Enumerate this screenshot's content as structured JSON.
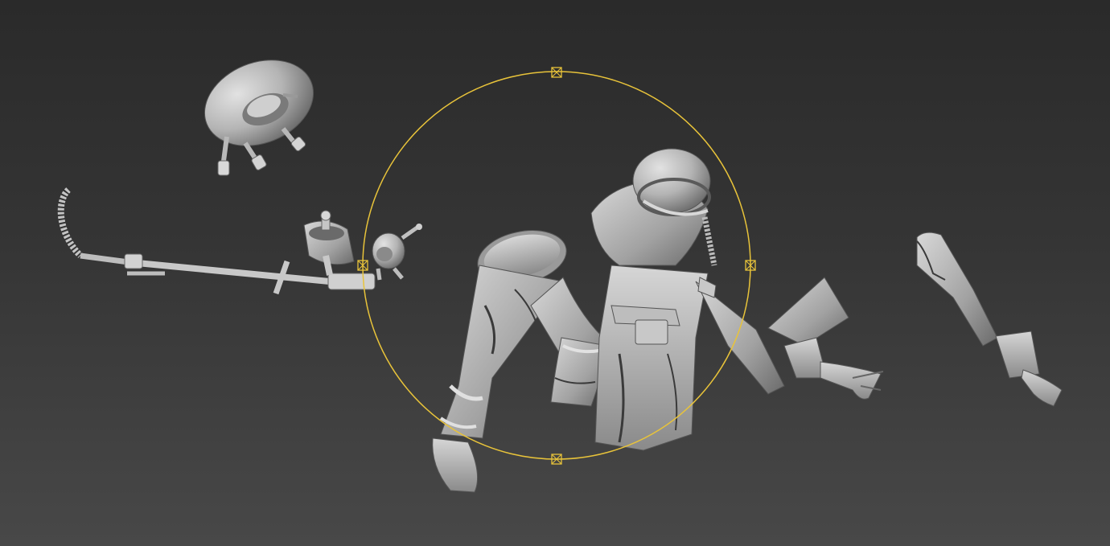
{
  "viewport": {
    "background_top": "#2a2a2a",
    "background_bottom": "#484848",
    "shading": "grey clay"
  },
  "gizmo": {
    "type": "rotate",
    "color": "#e8c33a",
    "handle_icon": "x-box-handle-icon"
  },
  "objects": [
    "inner-tube-with-straps",
    "grappling-hook-pole",
    "backpack-seat",
    "diving-helmet-small",
    "character-body",
    "left-leg",
    "right-leg",
    "right-arm-with-glove",
    "detached-arm"
  ],
  "colors": {
    "clay_light": "#d0d0d0",
    "clay_mid": "#a8a8a8",
    "clay_dark": "#6e6e6e",
    "crease": "#3a3a3a"
  }
}
